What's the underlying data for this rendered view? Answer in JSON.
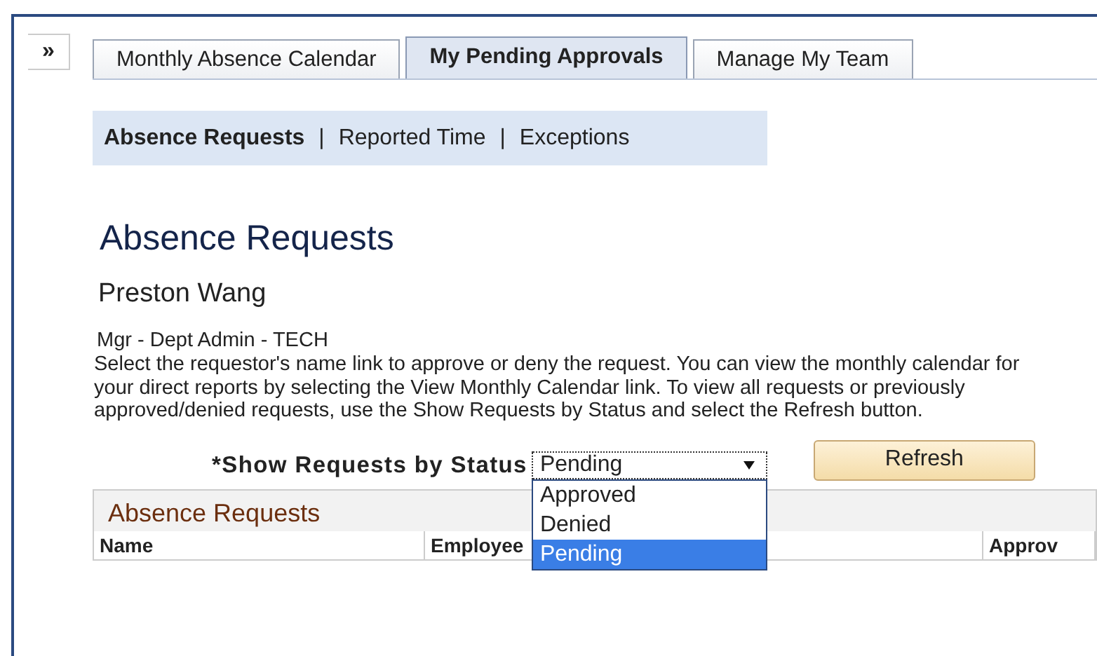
{
  "expand_button": {
    "label": "»"
  },
  "tabs": [
    {
      "label": "Monthly Absence Calendar",
      "selected": false
    },
    {
      "label": "My Pending Approvals",
      "selected": true
    },
    {
      "label": "Manage My Team",
      "selected": false
    }
  ],
  "subnav": [
    {
      "label": "Absence Requests",
      "selected": true
    },
    {
      "label": "Reported Time",
      "selected": false
    },
    {
      "label": "Exceptions",
      "selected": false
    }
  ],
  "subnav_separator": "|",
  "page_title": "Absence Requests",
  "employee_name": "Preston Wang",
  "role": "Mgr - Dept Admin - TECH",
  "instructions": "Select the requestor's name link to approve or deny the request. You can view the monthly calendar for your direct reports by selecting the View Monthly Calendar link. To view all requests or previously approved/denied requests, use the Show Requests by Status and select the Refresh button.",
  "status_filter": {
    "label": "*Show Requests by Status",
    "value": "Pending",
    "options": [
      {
        "label": "Approved",
        "selected": false
      },
      {
        "label": "Denied",
        "selected": false
      },
      {
        "label": "Pending",
        "selected": true
      }
    ]
  },
  "refresh_button": {
    "label": "Refresh"
  },
  "table": {
    "title": "Absence Requests",
    "columns": [
      "Name",
      "Employee",
      "Approv"
    ]
  }
}
